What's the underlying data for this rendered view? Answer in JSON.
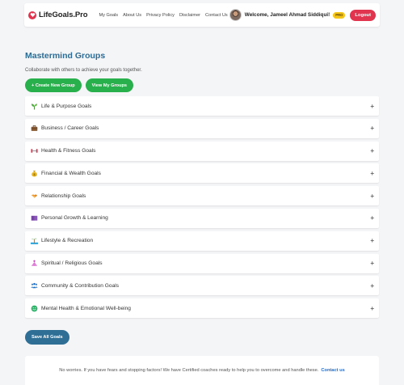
{
  "navbar": {
    "brand": "LifeGoals.Pro",
    "links": [
      "My Goals",
      "About Us",
      "Privacy Policy",
      "Disclaimer",
      "Contact Us"
    ],
    "welcome": "Welcome, Jameel Ahmad Siddiqui!",
    "badge": "PRO",
    "logout": "Logout"
  },
  "page": {
    "title": "Mastermind Groups",
    "subtitle": "Collaborate with others to achieve your goals together.",
    "create_button": "+ Create New Group",
    "view_button": "View My Groups"
  },
  "categories": [
    {
      "label": "Life & Purpose Goals",
      "icon": "seedling-icon"
    },
    {
      "label": "Business / Career Goals",
      "icon": "briefcase-icon"
    },
    {
      "label": "Health & Fitness Goals",
      "icon": "dumbbell-icon"
    },
    {
      "label": "Financial & Wealth Goals",
      "icon": "money-bag-icon"
    },
    {
      "label": "Relationship Goals",
      "icon": "handshake-icon"
    },
    {
      "label": "Personal Growth & Learning",
      "icon": "book-icon"
    },
    {
      "label": "Lifestyle & Recreation",
      "icon": "beach-icon"
    },
    {
      "label": "Spiritual / Religious Goals",
      "icon": "meditation-icon"
    },
    {
      "label": "Community & Contribution Goals",
      "icon": "people-icon"
    },
    {
      "label": "Mental Health & Emotional Well-being",
      "icon": "smile-icon"
    }
  ],
  "expand_symbol": "+",
  "save_button": "Save All Goals",
  "footer": {
    "text": "No worries. If you have fears and stopping factors! We have Certified coaches ready to help you to overcome and handle these.",
    "link": "Contact us"
  },
  "colors": {
    "brand": "#e0344f",
    "title": "#2e6a92",
    "green": "#27b04b",
    "save": "#2f6f96",
    "badge": "#f5c518"
  }
}
